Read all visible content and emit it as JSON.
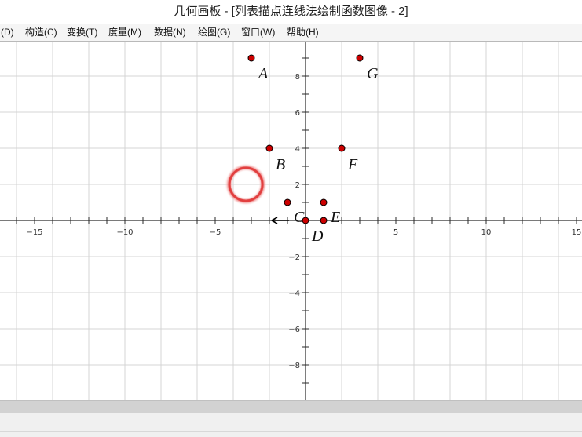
{
  "window": {
    "title": "几何画板 - [列表描点连线法绘制函数图像 - 2]"
  },
  "menu": [
    {
      "label": "(D)"
    },
    {
      "label": "构造(C)"
    },
    {
      "label": "变换(T)"
    },
    {
      "label": "度量(M)"
    },
    {
      "label": "数据(N)"
    },
    {
      "label": "绘图(G)"
    },
    {
      "label": "窗口(W)"
    },
    {
      "label": "帮助(H)"
    }
  ],
  "graph": {
    "x_range": [
      -17,
      15.2
    ],
    "y_range": [
      -10,
      10
    ],
    "x_ticks": [
      -15,
      -10,
      -5,
      5,
      10,
      15
    ],
    "y_ticks": [
      -8,
      -6,
      -4,
      -2,
      2,
      4,
      6,
      8
    ],
    "points": [
      {
        "label": "A",
        "x": -3,
        "y": 9
      },
      {
        "label": "B",
        "x": -2,
        "y": 4
      },
      {
        "label": "C",
        "x": -1,
        "y": 1
      },
      {
        "label": "D",
        "x": 0,
        "y": 0
      },
      {
        "label": "E",
        "x": 1,
        "y": 1
      },
      {
        "label": "F",
        "x": 2,
        "y": 4
      },
      {
        "label": "G",
        "x": 3,
        "y": 9
      }
    ],
    "extra_points": [
      {
        "x": 1,
        "y": 0
      }
    ],
    "highlight": {
      "x": -3.3,
      "y": 2
    },
    "colors": {
      "grid": "#d4d4d4",
      "axis": "#2a2a2a",
      "point_fill": "#cc0000",
      "point_stroke": "#000000",
      "highlight": "#e03a3a"
    }
  }
}
